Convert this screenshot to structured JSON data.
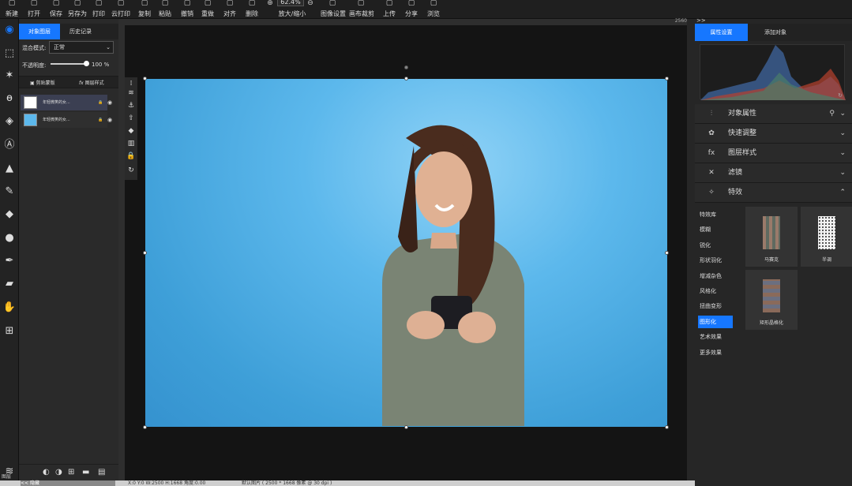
{
  "toolbar": {
    "items": [
      {
        "icon": "plus-icon",
        "label": "新建"
      },
      {
        "icon": "open-folder-icon",
        "label": "打开"
      },
      {
        "icon": "save-icon",
        "label": "保存"
      },
      {
        "icon": "save-as-icon",
        "label": "另存为"
      },
      {
        "icon": "print-icon",
        "label": "打印"
      },
      {
        "icon": "cloud-print-icon",
        "label": "云打印"
      },
      {
        "icon": "copy-icon",
        "label": "复制"
      },
      {
        "icon": "paste-icon",
        "label": "粘贴"
      },
      {
        "icon": "undo-icon",
        "label": "撤销"
      },
      {
        "icon": "redo-icon",
        "label": "重做"
      },
      {
        "icon": "align-icon",
        "label": "对齐"
      },
      {
        "icon": "delete-icon",
        "label": "删除"
      }
    ],
    "zoom_value": "62.4%",
    "zoom_label": "放大/缩小",
    "items_right": [
      {
        "icon": "image-settings-icon",
        "label": "图像设置"
      },
      {
        "icon": "crop-icon",
        "label": "画布裁剪"
      },
      {
        "icon": "upload-icon",
        "label": "上传"
      },
      {
        "icon": "share-icon",
        "label": "分享"
      },
      {
        "icon": "browse-icon",
        "label": "浏览"
      }
    ]
  },
  "left_panel": {
    "tabs": [
      "对象图层",
      "历史记录"
    ],
    "blend_label": "混合模式:",
    "blend_value": "正常",
    "opacity_label": "不透明度:",
    "opacity_value": "100 %",
    "opacity_fraction": 1.0,
    "sub_tabs": [
      "剪贴蒙版",
      "图层样式"
    ],
    "sub_tab_fx": "fx",
    "layers": [
      {
        "name": "年轻微笑的女...",
        "selected": true
      },
      {
        "name": "年轻微笑的女...",
        "selected": false
      }
    ],
    "bottom_label": "<< 隐藏"
  },
  "ruler": {
    "top_end": "2560"
  },
  "status": {
    "left": "X:0 Y:0 W:2500 H:1668 角度:0.00",
    "right": "默认图片 ( 2500 * 1668 像素 @ 30 dpi )",
    "layers_label": "图层"
  },
  "right_panel": {
    "collapse": ">>",
    "tabs": [
      "属性设置",
      "添加对象"
    ],
    "sections": [
      {
        "icon": "sliders-icon",
        "label": "对象属性",
        "open": false
      },
      {
        "icon": "palette-icon",
        "label": "快速调整",
        "open": false
      },
      {
        "icon": "fx-icon",
        "label": "图层样式",
        "open": false
      },
      {
        "icon": "filter-icon",
        "label": "滤镜",
        "open": false
      },
      {
        "icon": "magic-icon",
        "label": "特效",
        "open": true
      }
    ],
    "effect_categories": [
      "特效库",
      "模糊",
      "锐化",
      "形状羽化",
      "增减杂色",
      "风格化",
      "扭曲变形",
      "图形化",
      "艺术效果",
      "更多效果"
    ],
    "effect_selected": "图形化",
    "effect_cards": [
      "马赛克",
      "半调",
      "矩形晶格化"
    ]
  },
  "colors": {
    "accent": "#1677ff",
    "sky": "#5cb8ec"
  }
}
